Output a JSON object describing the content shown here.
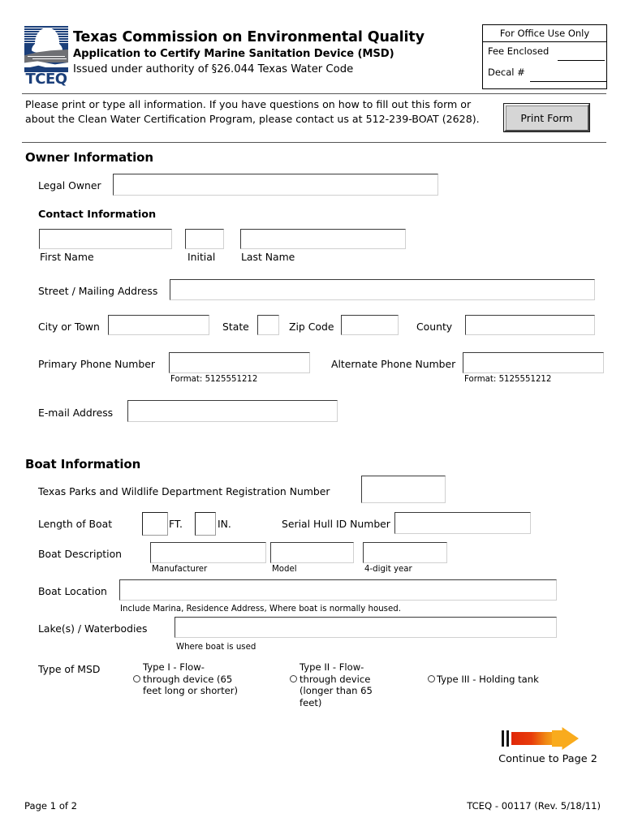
{
  "header": {
    "logo_wordmark": "TCEQ",
    "title_line1": "Texas Commission on Environmental Quality",
    "title_line2": "Application to Certify Marine Sanitation Device (MSD)",
    "title_line3": "Issued under authority of §26.044 Texas Water Code"
  },
  "office_box": {
    "title": "For Office Use Only",
    "fee_label": "Fee Enclosed",
    "decal_label": "Decal #"
  },
  "instructions": {
    "text": "Please print or type all information. If you have questions on how to fill out this form or about the Clean Water Certification Program, please contact us at 512-239-BOAT (2628).",
    "print_button": "Print Form"
  },
  "owner_section": {
    "heading": "Owner Information",
    "legal_owner_label": "Legal Owner",
    "legal_owner_value": "",
    "contact_heading": "Contact Information",
    "first_name_label": "First Name",
    "first_name_value": "",
    "initial_label": "Initial",
    "initial_value": "",
    "last_name_label": "Last Name",
    "last_name_value": "",
    "street_label": "Street / Mailing Address",
    "street_value": "",
    "city_label": "City or Town",
    "city_value": "",
    "state_label": "State",
    "state_value": "",
    "zip_label": "Zip Code",
    "zip_value": "",
    "county_label": "County",
    "county_value": "",
    "primary_phone_label": "Primary Phone Number",
    "primary_phone_value": "",
    "primary_phone_hint": "Format: 5125551212",
    "alternate_phone_label": "Alternate Phone Number",
    "alternate_phone_value": "",
    "alternate_phone_hint": "Format: 5125551212",
    "email_label": "E-mail Address",
    "email_value": ""
  },
  "boat_section": {
    "heading": "Boat Information",
    "tpwd_label": "Texas Parks and Wildlife Department Registration Number",
    "tpwd_value": "",
    "length_label": "Length of Boat",
    "length_ft_value": "",
    "length_ft_unit": "FT.",
    "length_in_value": "",
    "length_in_unit": "IN.",
    "hull_label": "Serial Hull ID Number",
    "hull_value": "",
    "description_label": "Boat Description",
    "manufacturer_value": "",
    "manufacturer_hint": "Manufacturer",
    "model_value": "",
    "model_hint": "Model",
    "year_value": "",
    "year_hint": "4-digit year",
    "location_label": "Boat Location",
    "location_value": "",
    "location_hint": "Include Marina, Residence Address, Where boat is normally housed.",
    "lakes_label": "Lake(s) / Waterbodies",
    "lakes_value": "",
    "lakes_hint": "Where boat is used",
    "msd_label": "Type of MSD",
    "msd_options": [
      {
        "label": "Type I - Flow-through device (65 feet long or shorter)",
        "selected": false
      },
      {
        "label": "Type II - Flow-through device (longer than 65 feet)",
        "selected": false
      },
      {
        "label": "Type III - Holding tank",
        "selected": false
      }
    ]
  },
  "continue": {
    "label": "Continue to Page 2"
  },
  "footer": {
    "page": "Page 1 of 2",
    "form_id": "TCEQ - 00117 (Rev. 5/18/11)"
  },
  "colors": {
    "logo_blue": "#1b3f7a",
    "logo_gray": "#6f7074",
    "arrow_red": "#e02708",
    "arrow_orange": "#f9ab1d"
  }
}
